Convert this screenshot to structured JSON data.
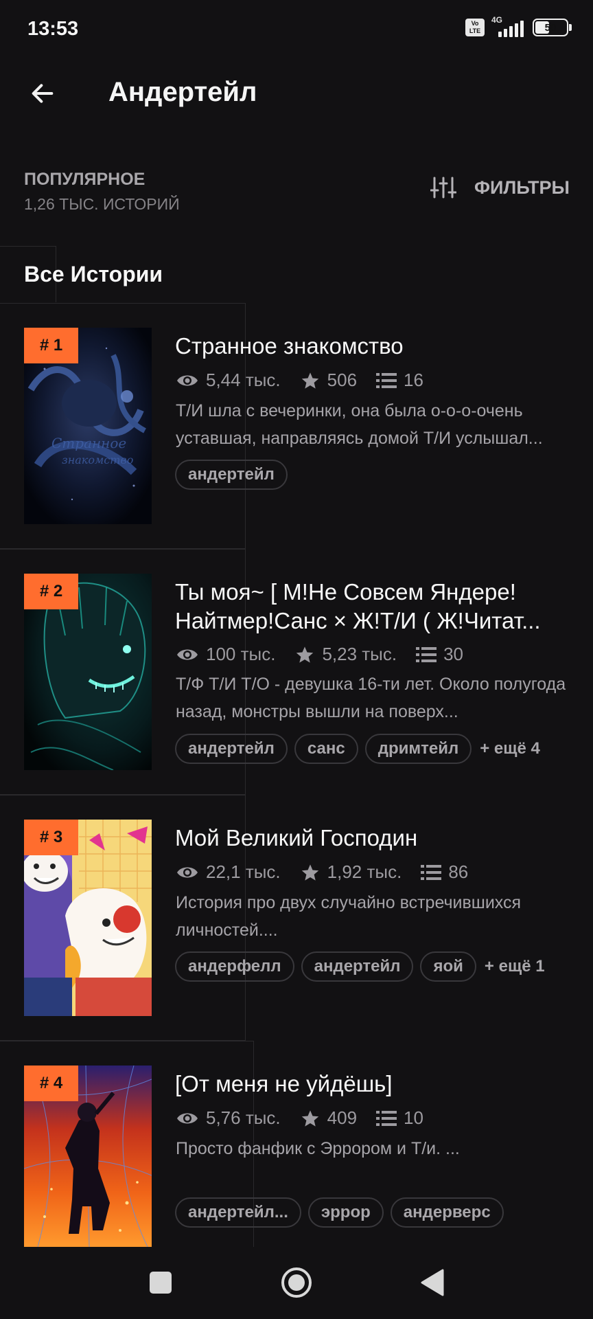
{
  "status": {
    "time": "13:53",
    "volte": "Vo LTE",
    "network": "4G",
    "battery": "50",
    "battery_level": 0.5
  },
  "header": {
    "title": "Андертейл"
  },
  "sort": {
    "title": "ПОПУЛЯРНОЕ",
    "count": "1,26 ТЫС. ИСТОРИЙ",
    "filters_label": "ФИЛЬТРЫ"
  },
  "section": {
    "title": "Все Истории"
  },
  "stories": [
    {
      "rank": "# 1",
      "title": "Странное знакомство",
      "views": "5,44 тыс.",
      "votes": "506",
      "parts": "16",
      "description": "Т/И шла с вечеринки, она была о-о-о-очень уставшая, направляясь домой Т/И услышал...",
      "tags": [
        "андертейл"
      ],
      "more": ""
    },
    {
      "rank": "# 2",
      "title": "Ты моя~ [ М!Не Совсем Яндере! Найтмер!Санс × Ж!Т/И ( Ж!Читат...",
      "views": "100 тыс.",
      "votes": "5,23 тыс.",
      "parts": "30",
      "description": "Т/Ф Т/И Т/О - девушка 16-ти лет. Около полугода назад, монстры вышли на поверх...",
      "tags": [
        "андертейл",
        "санс",
        "дримтейл"
      ],
      "more": "+ ещё 4"
    },
    {
      "rank": "# 3",
      "title": "Мой Великий Господин",
      "views": "22,1 тыс.",
      "votes": "1,92 тыс.",
      "parts": "86",
      "description": "История про двух случайно встречившихся личностей....",
      "tags": [
        "андерфелл",
        "андертейл",
        "яой"
      ],
      "more": "+ ещё 1"
    },
    {
      "rank": "# 4",
      "title": "[От меня не уйдёшь]",
      "views": "5,76 тыс.",
      "votes": "409",
      "parts": "10",
      "description": "Просто фанфик с Эррором и Т/и. ...",
      "tags": [
        "андертейл...",
        "эррор",
        "андерверс"
      ],
      "more": ""
    }
  ],
  "icons": {
    "back": "arrow-left-icon",
    "filters": "sliders-icon",
    "views": "eye-icon",
    "votes": "star-icon",
    "parts": "list-icon",
    "nav_recents": "square-icon",
    "nav_home": "circle-icon",
    "nav_back": "triangle-back-icon"
  },
  "colors": {
    "accent": "#ff6d2e",
    "background": "#121113",
    "text_secondary": "#a6a4a9"
  }
}
